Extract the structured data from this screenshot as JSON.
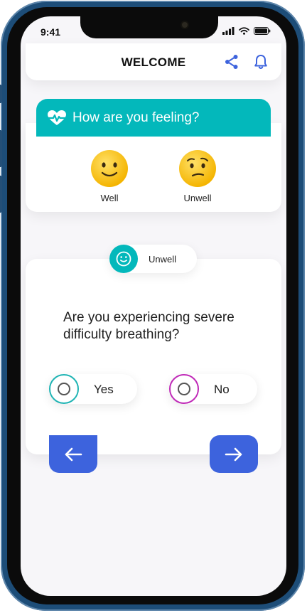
{
  "status_bar": {
    "time": "9:41"
  },
  "header": {
    "title": "WELCOME",
    "icons": [
      "share-icon",
      "bell-icon"
    ]
  },
  "feeling": {
    "title": "How are you feeling?",
    "icon": "heartbeat-icon",
    "options": [
      {
        "label": "Well",
        "icon": "smiling-face-icon"
      },
      {
        "label": "Unwell",
        "icon": "worried-face-icon"
      }
    ]
  },
  "selected_state": {
    "label": "Unwell",
    "icon": "smiley-outline-icon"
  },
  "question": {
    "text": "Are you experiencing severe difficulty breathing?",
    "answers": [
      {
        "label": "Yes",
        "color": "#1fb4b4"
      },
      {
        "label": "No",
        "color": "#c02ab8"
      }
    ]
  },
  "navigation": {
    "back_icon": "arrow-left-icon",
    "next_icon": "arrow-right-icon"
  },
  "colors": {
    "accent": "#03b8bb",
    "nav": "#3d63dd",
    "background": "#f7f6f9"
  }
}
